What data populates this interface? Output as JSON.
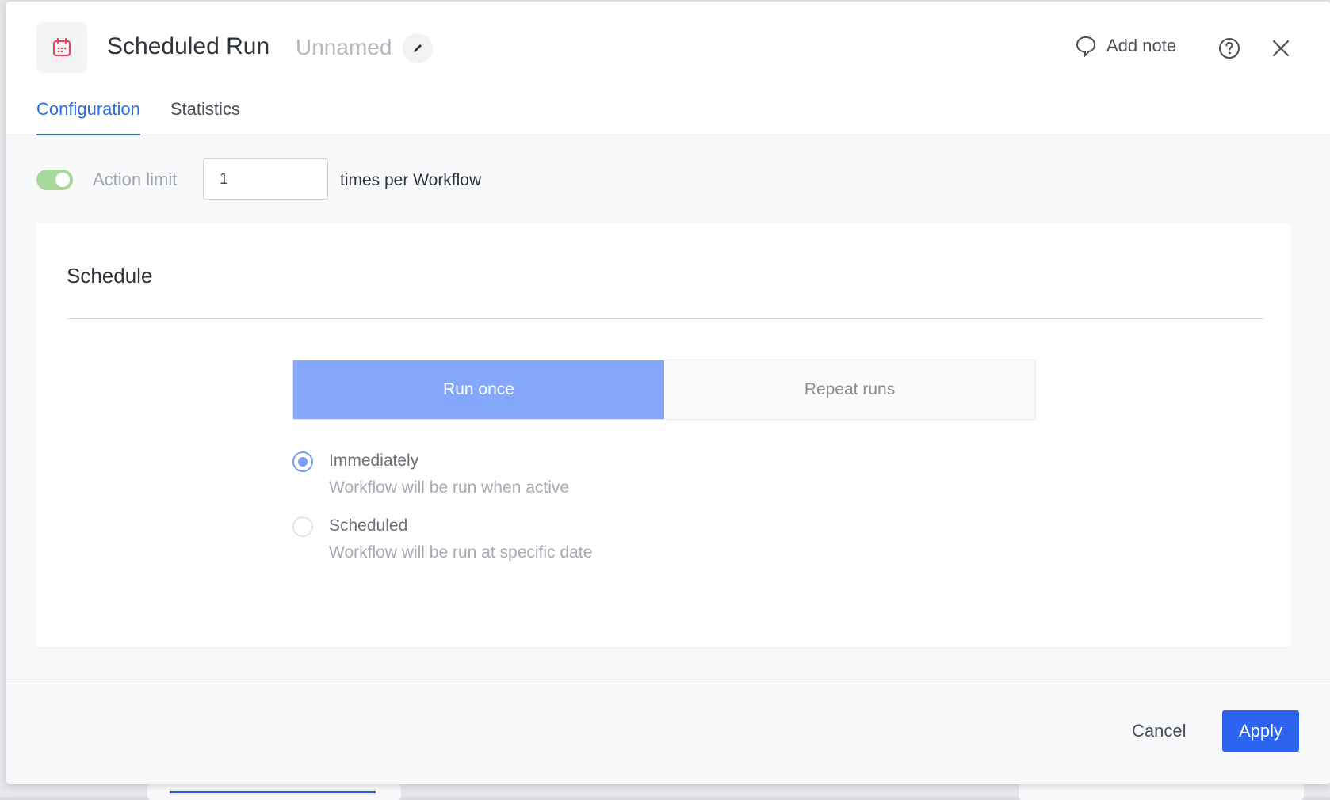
{
  "header": {
    "title": "Scheduled Run",
    "subtitle": "Unnamed",
    "add_note_label": "Add note"
  },
  "tabs": [
    {
      "label": "Configuration",
      "active": true
    },
    {
      "label": "Statistics",
      "active": false
    }
  ],
  "action_limit": {
    "enabled": true,
    "label": "Action limit",
    "value": "1",
    "suffix": "times per Workflow"
  },
  "schedule": {
    "title": "Schedule",
    "modes": [
      {
        "label": "Run once",
        "active": true
      },
      {
        "label": "Repeat runs",
        "active": false
      }
    ],
    "options": [
      {
        "title": "Immediately",
        "description": "Workflow will be run when active",
        "checked": true
      },
      {
        "title": "Scheduled",
        "description": "Workflow will be run at specific date",
        "checked": false
      }
    ]
  },
  "footer": {
    "cancel_label": "Cancel",
    "apply_label": "Apply"
  },
  "colors": {
    "accent": "#2c63f0",
    "active_tab": "#2a6de8",
    "segment_active": "#85a7fb",
    "toggle_on": "#a8d99a",
    "calendar_icon": "#e8475f"
  },
  "icons": {
    "app": "calendar-icon",
    "edit": "pencil-icon",
    "note": "speech-bubble-icon",
    "help": "question-circle-icon",
    "close": "close-icon"
  }
}
